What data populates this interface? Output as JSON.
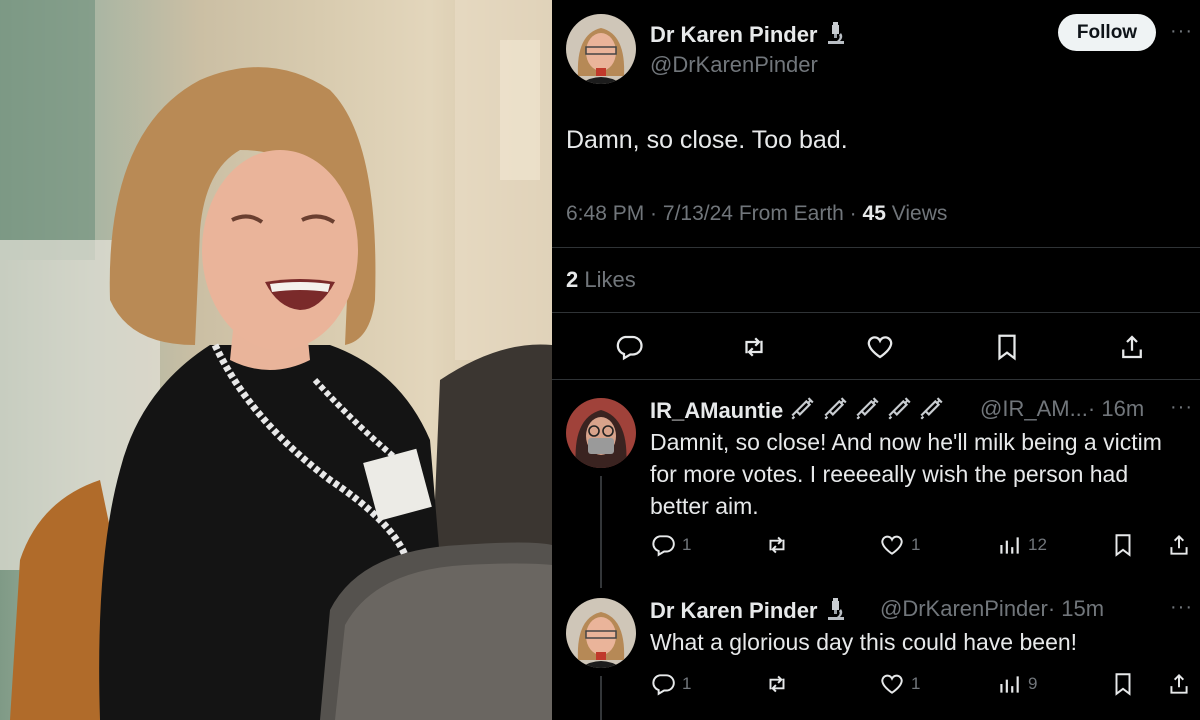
{
  "photo": {
    "alt": "smiling woman"
  },
  "tweet": {
    "author_name": "Dr Karen Pinder",
    "author_emoji": "microscope-emoji",
    "author_handle": "@DrKarenPinder",
    "follow_label": "Follow",
    "more": "···",
    "text": "Damn, so close. Too bad.",
    "time": "6:48 PM",
    "date": "7/13/24",
    "source": "From Earth",
    "views_count": "45",
    "views_label": "Views",
    "likes_count": "2",
    "likes_label": "Likes"
  },
  "replies": [
    {
      "name": "IR_AMauntie",
      "emoji": "syringe-emoji",
      "handle": "@IR_AM...",
      "time": "· 16m",
      "text": "Damnit, so close! And now he'll milk being a victim for more votes. I reeeeally wish the person had better aim.",
      "replies_count": "1",
      "reposts_count": "",
      "likes_count": "1",
      "views_count": "12"
    },
    {
      "name": "Dr Karen Pinder",
      "emoji": "microscope-emoji",
      "handle": "@DrKarenPinder",
      "time": "· 15m",
      "text": "What a glorious day this could have been!",
      "replies_count": "1",
      "reposts_count": "",
      "likes_count": "1",
      "views_count": "9"
    }
  ],
  "colors": {
    "background": "#000000",
    "text": "#e7e9ea",
    "muted": "#71767b",
    "divider": "#2f3336",
    "follow_bg": "#eff3f4"
  }
}
